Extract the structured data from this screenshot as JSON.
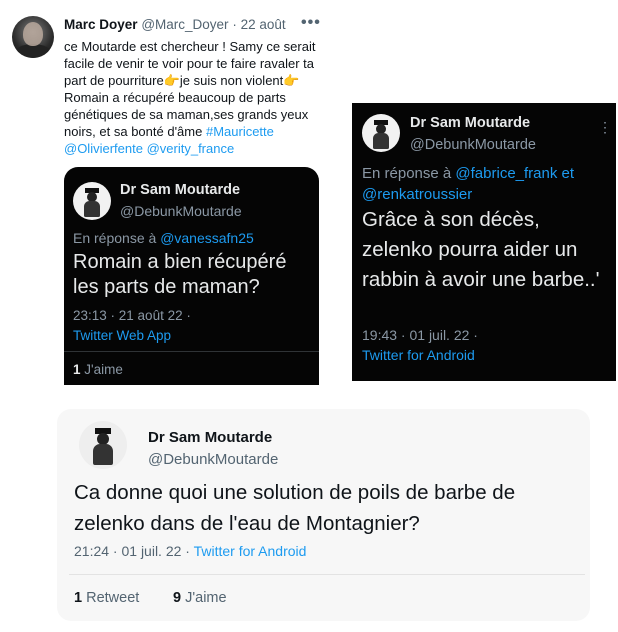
{
  "marc_tweet": {
    "name": "Marc Doyer",
    "handle": "@Marc_Doyer",
    "dot": "·",
    "date": "22 août",
    "more": "•••",
    "text_1": "ce Moutarde est chercheur ! Samy ce serait facile de venir te voir pour te faire ravaler ta part de pourriture",
    "emoji_1": "👉",
    "text_2": "je suis non violent",
    "emoji_2": "👉",
    "text_3": "Romain a récupéré beaucoup de parts génétiques de sa maman,ses grands yeux noirs, et sa bonté d'âme",
    "hashtag": "#Mauricette",
    "mention_1": "@Olivierfente",
    "mention_2": "@verity_france"
  },
  "quote_1": {
    "name": "Dr Sam Moutarde",
    "handle": "@DebunkMoutarde",
    "reply_prefix": "En réponse à",
    "reply_mention": "@vanessafn25",
    "text": "Romain a bien récupéré les parts de maman?",
    "time": "23:13 · 21 août 22 ·",
    "source": "Twitter Web App",
    "likes_count": "1",
    "likes_label": "J'aime"
  },
  "card_2": {
    "name": "Dr Sam Moutarde",
    "handle": "@DebunkMoutarde",
    "more": "⋮",
    "reply_prefix": "En réponse à",
    "reply_mention_1": "@fabrice_frank",
    "reply_et": "et",
    "reply_mention_2": "@renkatroussier",
    "text": "Grâce à son décès, zelenko pourra aider un rabbin à avoir une barbe..'",
    "time": "19:43 · 01 juil. 22 ·",
    "source": "Twitter for Android"
  },
  "card_3": {
    "name": "Dr Sam Moutarde",
    "handle": "@DebunkMoutarde",
    "text": "Ca donne quoi une solution de poils de barbe de zelenko dans de l'eau de Montagnier?",
    "time": "21:24 · 01 juil. 22 ·",
    "source": "Twitter for Android",
    "retweets_count": "1",
    "retweets_label": "Retweet",
    "likes_count": "9",
    "likes_label": "J'aime"
  }
}
